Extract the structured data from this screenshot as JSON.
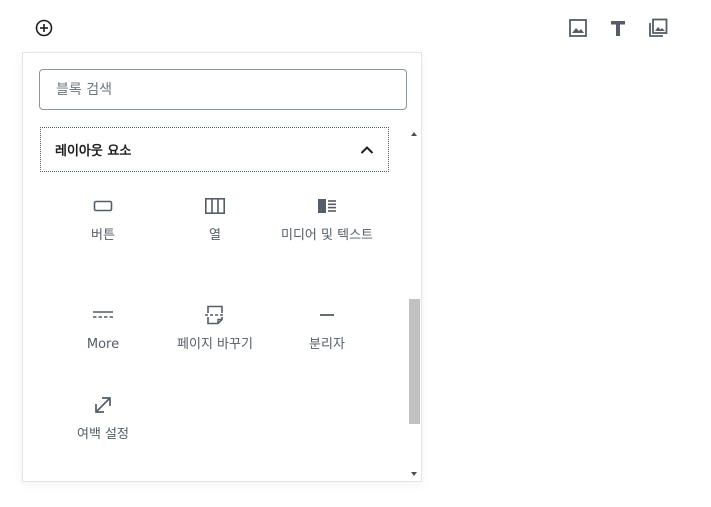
{
  "top_bar": {
    "add_block_icon": "plus-circle-icon",
    "toolbar": [
      {
        "name": "image-icon"
      },
      {
        "name": "text-icon"
      },
      {
        "name": "gallery-icon"
      }
    ]
  },
  "inserter": {
    "search": {
      "placeholder": "블록 검색",
      "value": ""
    },
    "panel": {
      "title": "레이아웃 요소",
      "expanded": true,
      "items": [
        {
          "label": "버튼",
          "icon": "button-icon"
        },
        {
          "label": "열",
          "icon": "columns-icon"
        },
        {
          "label": "미디어 및 텍스트",
          "icon": "media-text-icon"
        },
        {
          "label": "More",
          "icon": "more-icon"
        },
        {
          "label": "페이지 바꾸기",
          "icon": "page-break-icon"
        },
        {
          "label": "분리자",
          "icon": "separator-icon"
        },
        {
          "label": "여백 설정",
          "icon": "spacer-icon"
        }
      ]
    }
  },
  "colors": {
    "icon": "#555d66",
    "border": "#8d96a0",
    "text": "#1e1e1e"
  }
}
